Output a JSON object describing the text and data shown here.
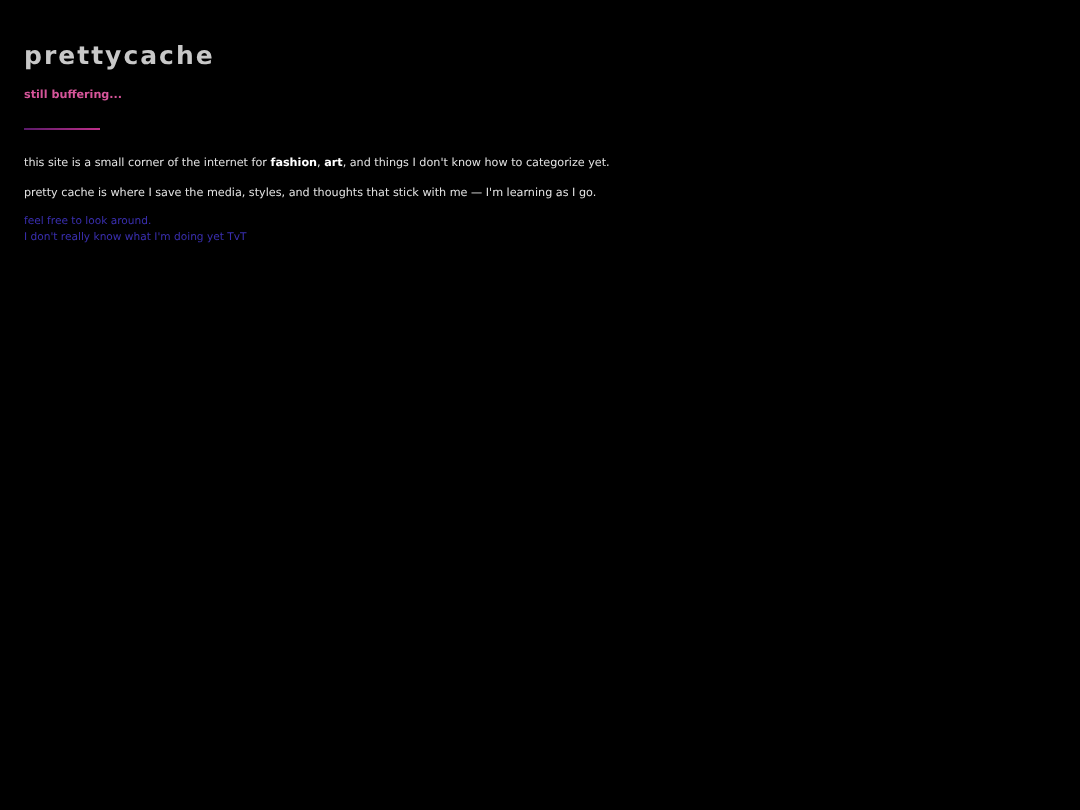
{
  "site_title": "prettycache",
  "tagline": "still buffering...",
  "paragraphs": [
    "this site is a small corner of the internet for **fashion**, **art**, and things I don't know how to categorize yet.",
    "pretty cache is where I save the media, styles, and thoughts that stick with me — I'm learning as I go."
  ],
  "notes": [
    "feel free to look around.",
    "I don't really know what I'm doing yet TvT"
  ]
}
